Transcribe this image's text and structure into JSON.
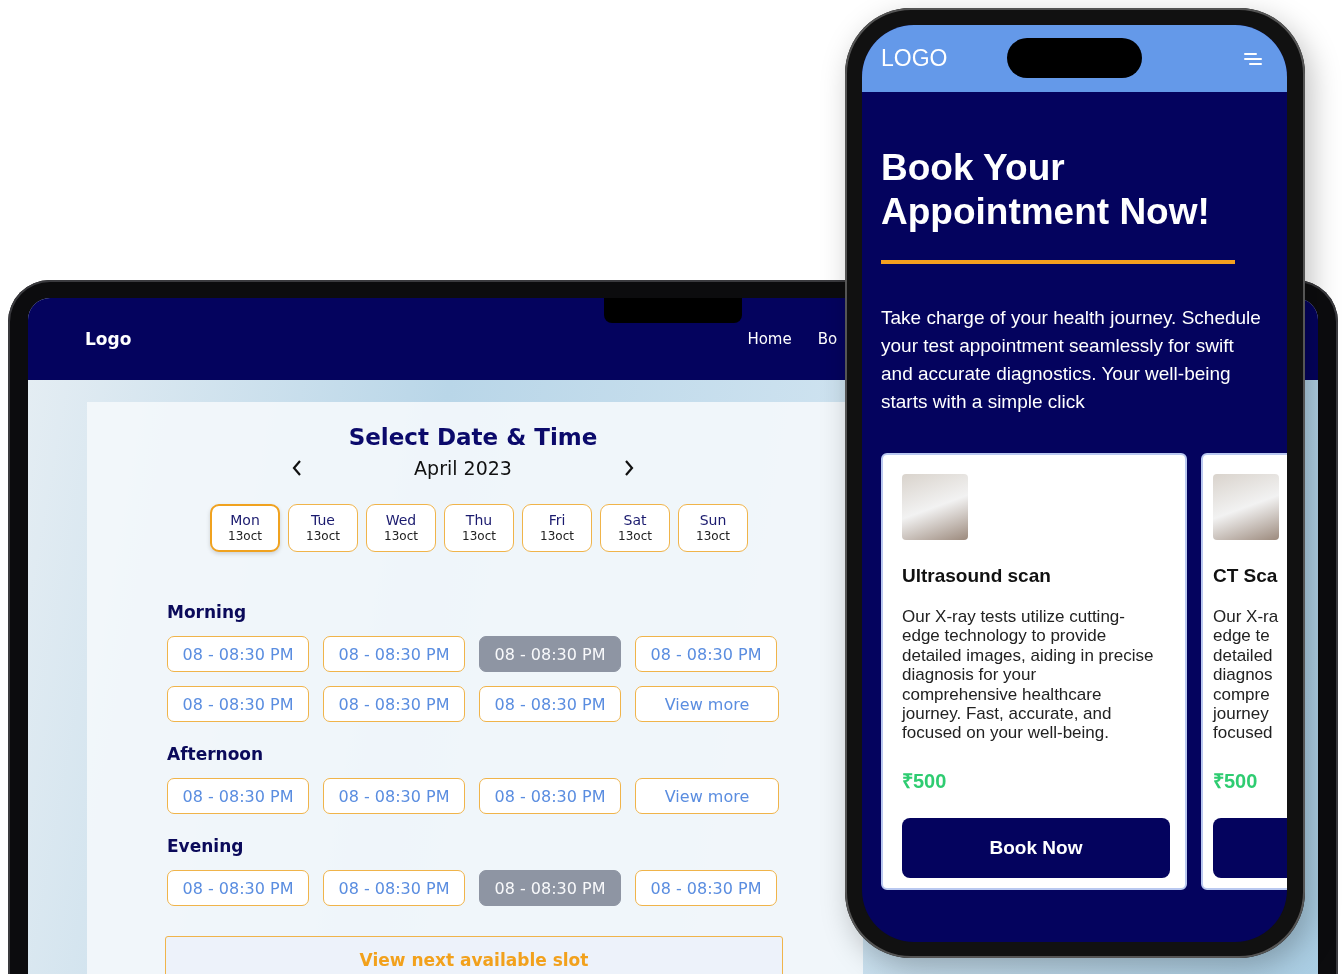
{
  "tablet": {
    "nav": {
      "logo": "Logo",
      "links": [
        "Home",
        "Bo"
      ]
    },
    "booking": {
      "title": "Select Date & Time",
      "month": "April 2023",
      "days": [
        {
          "day": "Mon",
          "date": "13oct",
          "selected": true
        },
        {
          "day": "Tue",
          "date": "13oct",
          "selected": false
        },
        {
          "day": "Wed",
          "date": "13oct",
          "selected": false
        },
        {
          "day": "Thu",
          "date": "13oct",
          "selected": false
        },
        {
          "day": "Fri",
          "date": "13oct",
          "selected": false
        },
        {
          "day": "Sat",
          "date": "13oct",
          "selected": false
        },
        {
          "day": "Sun",
          "date": "13oct",
          "selected": false
        }
      ],
      "sections": [
        {
          "label": "Morning",
          "slots": [
            {
              "kind": "time",
              "text": "08 - 08:30 PM",
              "disabled": false
            },
            {
              "kind": "time",
              "text": "08 - 08:30 PM",
              "disabled": false
            },
            {
              "kind": "time",
              "text": "08 - 08:30 PM",
              "disabled": true
            },
            {
              "kind": "time",
              "text": "08 - 08:30 PM",
              "disabled": false
            },
            {
              "kind": "time",
              "text": "08 - 08:30 PM",
              "disabled": false
            },
            {
              "kind": "time",
              "text": "08 - 08:30 PM",
              "disabled": false
            },
            {
              "kind": "time",
              "text": "08 - 08:30 PM",
              "disabled": false
            },
            {
              "kind": "more",
              "text": "View more",
              "disabled": false
            }
          ]
        },
        {
          "label": "Afternoon",
          "slots": [
            {
              "kind": "time",
              "text": "08 - 08:30 PM",
              "disabled": false
            },
            {
              "kind": "time",
              "text": "08 - 08:30 PM",
              "disabled": false
            },
            {
              "kind": "time",
              "text": "08 - 08:30 PM",
              "disabled": false
            },
            {
              "kind": "more",
              "text": "View more",
              "disabled": false
            }
          ]
        },
        {
          "label": "Evening",
          "slots": [
            {
              "kind": "time",
              "text": "08 - 08:30 PM",
              "disabled": false
            },
            {
              "kind": "time",
              "text": "08 - 08:30 PM",
              "disabled": false
            },
            {
              "kind": "time",
              "text": "08 - 08:30 PM",
              "disabled": true
            },
            {
              "kind": "time",
              "text": "08 - 08:30 PM",
              "disabled": false
            }
          ]
        }
      ],
      "next_slot_button": "View next available slot"
    }
  },
  "phone": {
    "logo": "LOGO",
    "heading": "Book Your Appointment Now!",
    "intro": "Take charge of your health journey. Schedule your test appointment seamlessly for swift and accurate diagnostics. Your well-being starts with a simple click",
    "cards": [
      {
        "title": "Ultrasound scan",
        "lines": [
          "Our X-ray tests utilize cutting-",
          "edge technology to provide",
          "detailed images, aiding in precise",
          "diagnosis for your",
          "comprehensive healthcare",
          "journey. Fast, accurate, and",
          "focused on your well-being."
        ],
        "price": "₹500",
        "button": "Book Now"
      },
      {
        "title": "CT Sca",
        "lines": [
          "Our X-ra",
          "edge te",
          "detailed",
          "diagnos",
          "compre",
          "journey",
          "focused"
        ],
        "price": "₹500"
      }
    ]
  }
}
